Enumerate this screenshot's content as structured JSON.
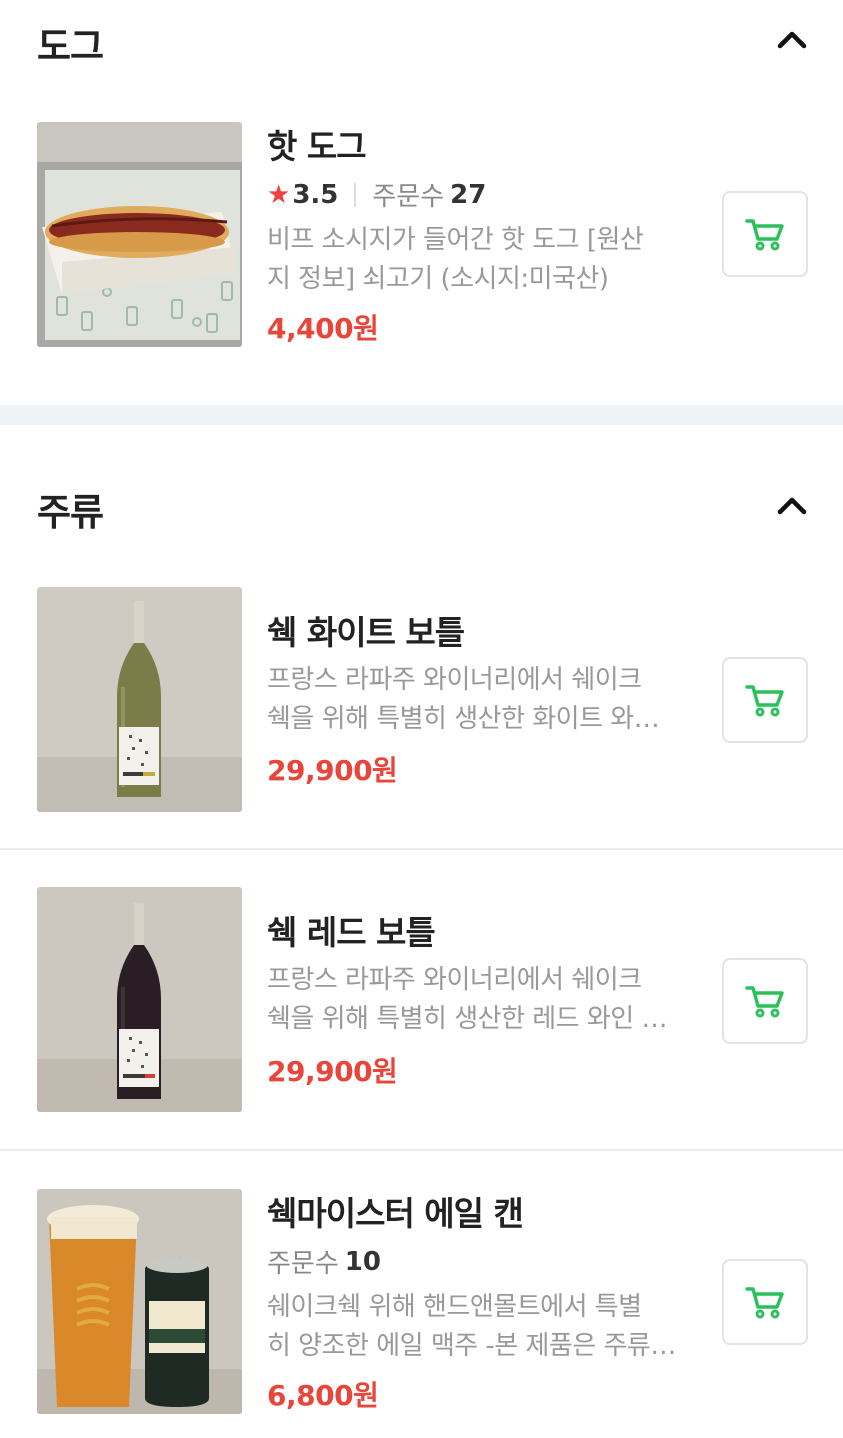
{
  "sections": [
    {
      "title": "도그",
      "items": [
        {
          "name": "핫 도그",
          "star": "★",
          "rating": "3.5",
          "orders_label": "주문수",
          "orders_count": "27",
          "desc_lines": [
            "비프 소시지가 들어간 핫 도그 [원산",
            "지 정보] 쇠고기 (소시지:미국산)"
          ],
          "price": "4,400원"
        }
      ]
    },
    {
      "title": "주류",
      "items": [
        {
          "name": "쉑 화이트 보틀",
          "desc_lines": [
            "프랑스 라파주 와이너리에서 쉐이크",
            "쉑을 위해 특별히 생산한 화이트 와인 한정판입니다"
          ],
          "price": "29,900원"
        },
        {
          "name": "쉑 레드 보틀",
          "desc_lines": [
            "프랑스 라파주 와이너리에서 쉐이크",
            "쉑을 위해 특별히 생산한 레드 와인 한정판입니다"
          ],
          "price": "29,900원"
        },
        {
          "name": "쉑마이스터 에일 캔",
          "orders_label": "주문수",
          "orders_count": "10",
          "desc_lines": [
            "쉐이크쉑 위해 핸드앤몰트에서 특별",
            "히 양조한 에일 맥주 -본 제품은 주류입니다"
          ],
          "price": "6,800원"
        }
      ]
    }
  ],
  "colors": {
    "price": "#e8463b",
    "star": "#f0413f",
    "cart_icon": "#2ac15a",
    "divider": "#f0f3f6"
  },
  "icons": {
    "collapse": "chevron-up-icon",
    "cart": "cart-icon",
    "rating": "star-icon"
  }
}
